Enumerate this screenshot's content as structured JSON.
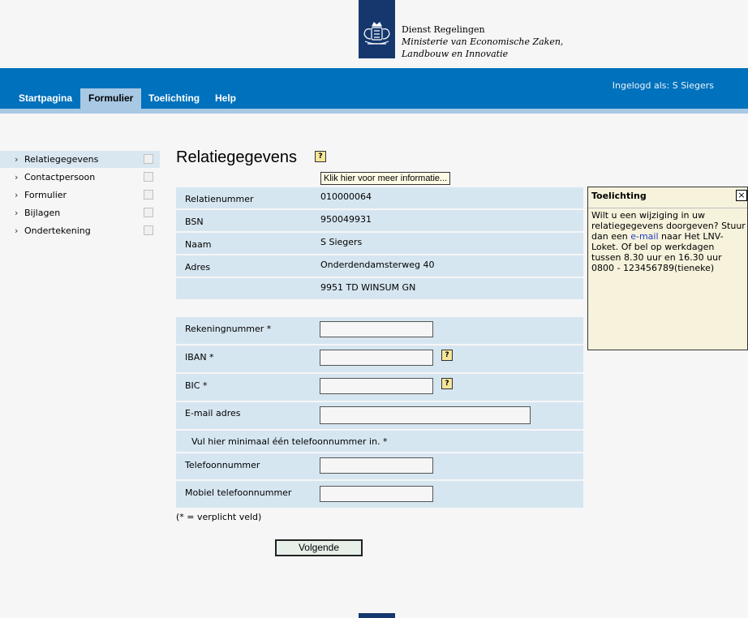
{
  "header": {
    "org_name": "Dienst Regelingen",
    "ministry_line1": "Ministerie van Economische Zaken,",
    "ministry_line2": "Landbouw en Innovatie",
    "login": "Ingelogd als: S Siegers"
  },
  "nav": {
    "tabs": [
      "Startpagina",
      "Formulier",
      "Toelichting",
      "Help"
    ],
    "active": "Formulier"
  },
  "sidebar": {
    "items": [
      "Relatiegegevens",
      "Contactpersoon",
      "Formulier",
      "Bijlagen",
      "Ondertekening"
    ],
    "active": "Relatiegegevens"
  },
  "main": {
    "title": "Relatiegegevens",
    "help_tooltip": "Klik hier voor meer informatie...",
    "details": [
      {
        "label": "Relatienummer",
        "value": "010000064"
      },
      {
        "label": "BSN",
        "value": "950049931"
      },
      {
        "label": "Naam",
        "value": "S Siegers"
      },
      {
        "label": "Adres",
        "value": "Onderdendamsterweg 40"
      },
      {
        "label": "",
        "value": "9951 TD WINSUM GN"
      }
    ],
    "fields": {
      "rekeningnummer": {
        "label": "Rekeningnummer *",
        "value": ""
      },
      "iban": {
        "label": "IBAN *",
        "value": ""
      },
      "bic": {
        "label": "BIC *",
        "value": ""
      },
      "email": {
        "label": "E-mail adres",
        "value": ""
      },
      "phone_note": "Vul hier minimaal één telefoonnummer in. *",
      "telefoon": {
        "label": "Telefoonnummer",
        "value": ""
      },
      "mobiel": {
        "label": "Mobiel telefoonnummer",
        "value": ""
      }
    },
    "required_note": "(* = verplicht veld)",
    "next_button": "Volgende",
    "help_glyph": "?"
  },
  "info_panel": {
    "title": "Toelichting",
    "close_glyph": "×",
    "text_before": "Wilt u een wijziging in uw relatiegegevens doorgeven? Stuur dan een ",
    "link": "e-mail",
    "text_after": " naar Het LNV-Loket. Of bel op werkdagen tussen 8.30 uur en 16.30 uur 0800 - 123456789(tieneke)"
  },
  "colors": {
    "brand_dark": "#15376e",
    "topbar": "#0071bc",
    "active_tab": "#a8c8e4",
    "row_bg": "#d6e6f1",
    "panel_bg": "#f6f2dc"
  }
}
